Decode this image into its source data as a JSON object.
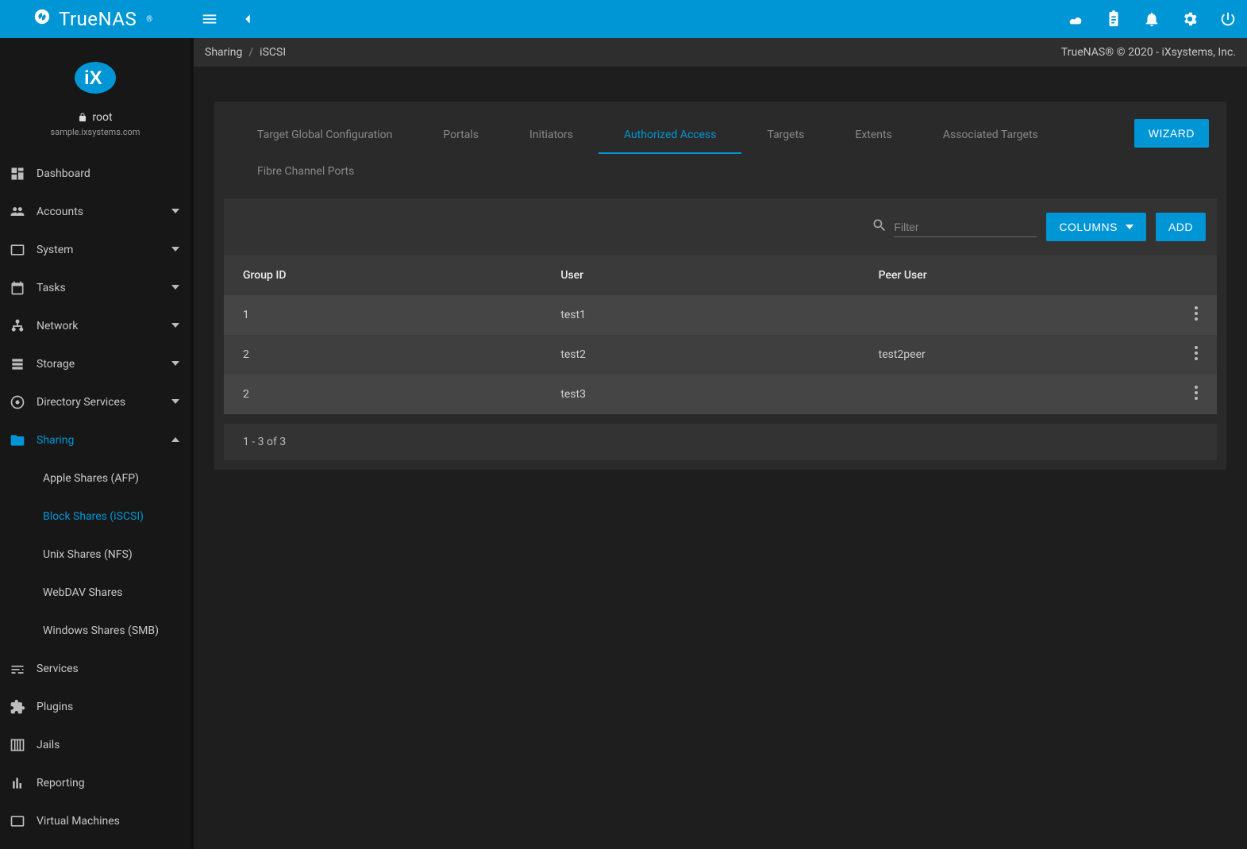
{
  "brand": "TrueNAS",
  "breadcrumb": {
    "root": "Sharing",
    "leaf": "iSCSI"
  },
  "copyright": "TrueNAS® © 2020 - iXsystems, Inc.",
  "user": {
    "name": "root",
    "host": "sample.ixsystems.com"
  },
  "sidebar": {
    "items": [
      {
        "label": "Dashboard",
        "expandable": false
      },
      {
        "label": "Accounts",
        "expandable": true
      },
      {
        "label": "System",
        "expandable": true
      },
      {
        "label": "Tasks",
        "expandable": true
      },
      {
        "label": "Network",
        "expandable": true
      },
      {
        "label": "Storage",
        "expandable": true
      },
      {
        "label": "Directory Services",
        "expandable": true
      },
      {
        "label": "Sharing",
        "expandable": true,
        "active": true,
        "expanded": true
      },
      {
        "label": "Services",
        "expandable": false
      },
      {
        "label": "Plugins",
        "expandable": false
      },
      {
        "label": "Jails",
        "expandable": false
      },
      {
        "label": "Reporting",
        "expandable": false
      },
      {
        "label": "Virtual Machines",
        "expandable": false
      }
    ],
    "sharing_sub": [
      {
        "label": "Apple Shares (AFP)"
      },
      {
        "label": "Block Shares (iSCSI)",
        "active": true
      },
      {
        "label": "Unix Shares (NFS)"
      },
      {
        "label": "WebDAV Shares"
      },
      {
        "label": "Windows Shares (SMB)"
      }
    ]
  },
  "card": {
    "wizard_label": "WIZARD",
    "tabs": [
      {
        "label": "Target Global Configuration"
      },
      {
        "label": "Portals"
      },
      {
        "label": "Initiators"
      },
      {
        "label": "Authorized Access",
        "active": true
      },
      {
        "label": "Targets"
      },
      {
        "label": "Extents"
      },
      {
        "label": "Associated Targets"
      },
      {
        "label": "Fibre Channel Ports"
      }
    ],
    "toolbar": {
      "filter_placeholder": "Filter",
      "columns_label": "COLUMNS",
      "add_label": "ADD"
    },
    "table": {
      "columns": [
        "Group ID",
        "User",
        "Peer User"
      ],
      "rows": [
        {
          "group_id": "1",
          "user": "test1",
          "peer_user": ""
        },
        {
          "group_id": "2",
          "user": "test2",
          "peer_user": "test2peer"
        },
        {
          "group_id": "2",
          "user": "test3",
          "peer_user": ""
        }
      ],
      "footer": "1 - 3 of 3"
    }
  }
}
